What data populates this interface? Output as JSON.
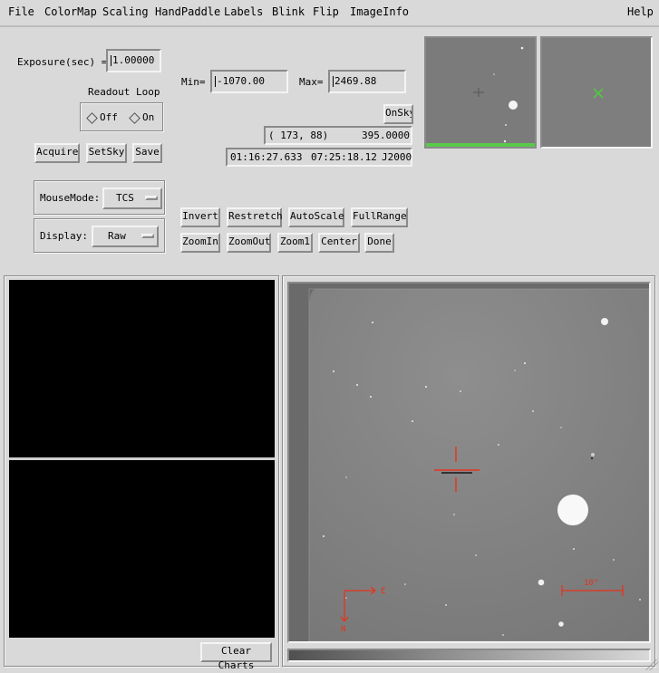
{
  "menu": {
    "items": [
      "File",
      "ColorMap",
      "Scaling",
      "HandPaddle",
      "Labels",
      "Blink",
      "Flip",
      "ImageInfo"
    ],
    "help": "Help"
  },
  "exposure": {
    "label": "Exposure(sec) =",
    "value": "1.00000"
  },
  "readout": {
    "label": "Readout Loop",
    "off": "Off",
    "on": "On",
    "selected": "Off"
  },
  "actions": {
    "acquire": "Acquire",
    "setsky": "SetSky",
    "save": "Save"
  },
  "mousemode": {
    "label": "MouseMode:",
    "value": "TCS"
  },
  "display": {
    "label": "Display:",
    "value": "Raw"
  },
  "range": {
    "min_label": "Min=",
    "min_value": "-1070.00",
    "max_label": "Max=",
    "max_value": "2469.88"
  },
  "onsky": "OnSky",
  "pixel_readout": {
    "coords": "( 173,  88)",
    "value": "395.0000"
  },
  "radec_readout": {
    "ra": "01:16:27.633",
    "dec": "07:25:18.12",
    "epoch": "J2000"
  },
  "image_buttons": {
    "row1": [
      "Invert",
      "Restretch",
      "AutoScale",
      "FullRange"
    ],
    "row2": [
      "ZoomIn",
      "ZoomOut",
      "Zoom1",
      "Center",
      "Done"
    ]
  },
  "clear_charts": "Clear Charts",
  "image_overlay": {
    "east": "E",
    "north": "N",
    "scale": "10\""
  },
  "colors": {
    "background": "#d9d9d9",
    "overlay_red": "#e8321c",
    "cursor_green": "#4bd23a"
  }
}
